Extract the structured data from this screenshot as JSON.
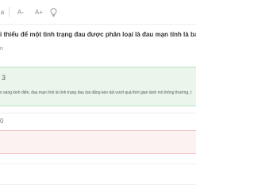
{
  "toolbar": {
    "partial_label": "a",
    "font_decrease_label": "A-",
    "font_increase_label": "A+",
    "hint_icon": "lightbulb-icon"
  },
  "question": {
    "text": "i thiểu để một tình trạng đau được phân loại là đau mạn tính là bao lâu?",
    "sub_label": "n"
  },
  "correct_answer": {
    "letter": "3",
    "explanation": "n sàng kinh điển, đau mạn tính là tình trạng đau dai dẳng kéo dài vượt quá thời gian lành mô thông thường, t"
  },
  "option": {
    "letter": "0"
  },
  "colors": {
    "correct_bg": "#eaf6ec",
    "correct_border": "#b9dfc0",
    "wrong_bg": "#fdf2f2",
    "wrong_border": "#f2c6c6"
  }
}
